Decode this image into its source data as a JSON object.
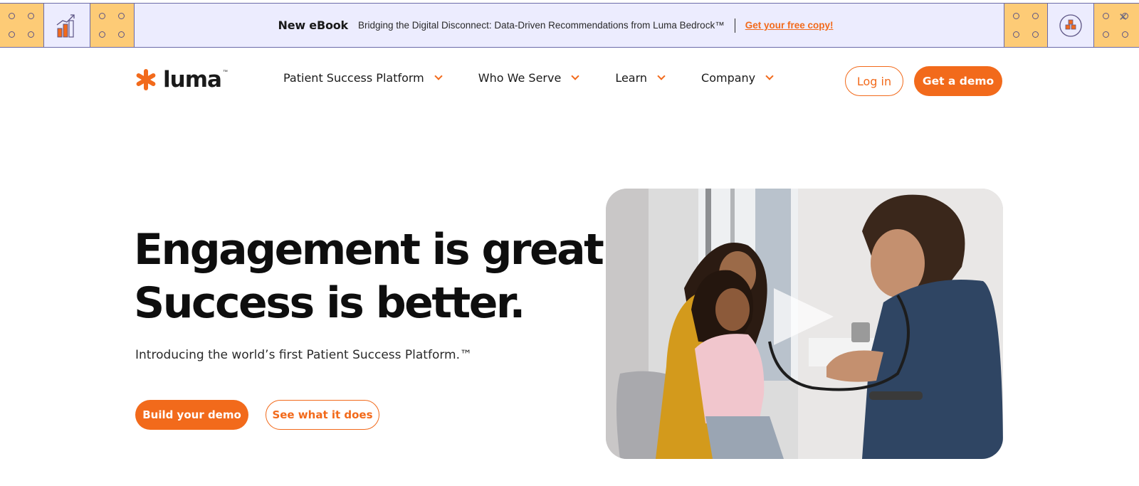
{
  "banner": {
    "title": "New eBook",
    "text": "Bridging the Digital Disconnect: Data-Driven Recommendations from Luma Bedrock™",
    "link": "Get your free copy!",
    "close_glyph": "✕",
    "icons": [
      "growth-chart-icon",
      "building-blocks-icon"
    ]
  },
  "header": {
    "logo_text": "luma",
    "logo_tm": "™",
    "nav": [
      {
        "label": "Patient Success Platform"
      },
      {
        "label": "Who We Serve"
      },
      {
        "label": "Learn"
      },
      {
        "label": "Company"
      }
    ],
    "login_label": "Log in",
    "demo_label": "Get a demo"
  },
  "hero": {
    "headline_line1": "Engagement is great.",
    "headline_line2": "Success is better.",
    "subtitle": "Introducing the world’s first Patient Success Platform.™",
    "primary_cta": "Build your demo",
    "secondary_cta": "See what it does"
  },
  "colors": {
    "accent": "#f26a1b",
    "banner_bg": "#ececfe",
    "tile_yellow": "#fdcb76",
    "text": "#0e0e0e"
  }
}
